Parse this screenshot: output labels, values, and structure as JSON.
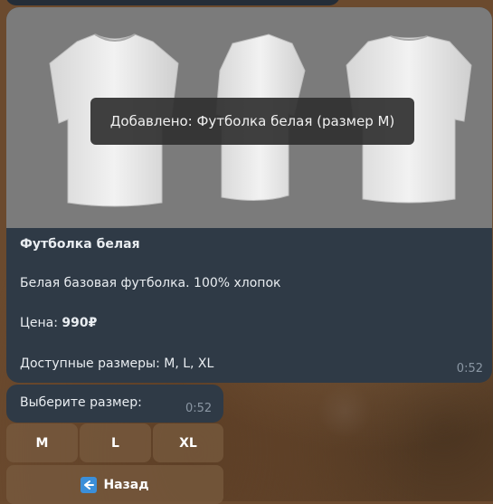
{
  "product": {
    "toast": "Добавлено: Футболка белая (размер M)",
    "title": "Футболка белая",
    "description": "Белая базовая футболка. 100% хлопок",
    "price_label": "Цена: ",
    "price_value": "990₽",
    "sizes_text": "Доступные размеры: M, L, XL",
    "time": "0:52"
  },
  "prompt": {
    "text": "Выберите размер:",
    "time": "0:52"
  },
  "keyboard": {
    "sizes": [
      "M",
      "L",
      "XL"
    ],
    "back_label": "Назад",
    "back_icon": "back-arrow-icon"
  },
  "colors": {
    "bubble": "#2f3a46",
    "image_bg": "#7b7b7b",
    "button": "#785c40",
    "back_icon": "#3b8fd9"
  }
}
